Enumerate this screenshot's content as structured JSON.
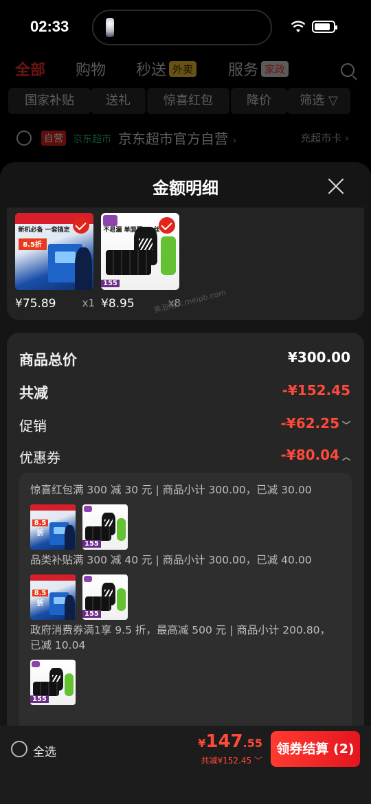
{
  "status_bar": {
    "time": "02:33"
  },
  "nav": {
    "tabs": [
      {
        "label": "全部"
      },
      {
        "label": "购物"
      },
      {
        "label": "秒送",
        "tag": "外卖"
      },
      {
        "label": "服务",
        "tag": "家政"
      }
    ],
    "chips": [
      "国家补贴",
      "送礼",
      "惊喜红包",
      "降价",
      "筛选"
    ]
  },
  "shop": {
    "self_badge": "自营",
    "chaoshi": "京东超市",
    "name": "京东超市官方自营",
    "card_link": "充超市卡"
  },
  "sheet": {
    "title": "金额明细",
    "products": [
      {
        "price": "¥75.89",
        "qty": "x1",
        "img_text": "新机必备 一套搞定",
        "img_pct": "8.5折"
      },
      {
        "price": "¥8.95",
        "qty": "x8",
        "img_text": "不易漏 单面厚1.3丝",
        "img_num": "155"
      }
    ],
    "watermark": "美泡泡 k.meipb.com",
    "summary": {
      "total_label": "商品总价",
      "total_value": "¥300.00",
      "reduce_label": "共减",
      "reduce_value": "-¥152.45",
      "promo_label": "促销",
      "promo_value": "-¥62.25",
      "coupon_label": "优惠券",
      "coupon_value": "-¥80.04"
    },
    "coupons": [
      {
        "desc": "惊喜红包满 300 减 30 元 | 商品小计 300.00，已减 30.00"
      },
      {
        "desc": "品类补贴满 300 减 40 元 | 商品小计 300.00，已减 40.00"
      },
      {
        "desc": "政府消费券满1享 9.5 折，最高减 500 元 | 商品小计 200.80，已减 10.04"
      }
    ]
  },
  "bottom_bar": {
    "select_all": "全选",
    "yen": "¥",
    "total_int": "147",
    "total_dec": ".55",
    "saved": "共减¥152.45",
    "pay_button": "领券结算 (2)"
  },
  "colors": {
    "accent_red": "#ff4a3a",
    "sheet_bg": "#151515",
    "card_bg": "#262626"
  },
  "icons": [
    "wifi-icon",
    "battery-icon",
    "search-icon",
    "filter-icon",
    "close-icon",
    "check-icon",
    "chevron-down-icon",
    "chevron-up-icon"
  ]
}
